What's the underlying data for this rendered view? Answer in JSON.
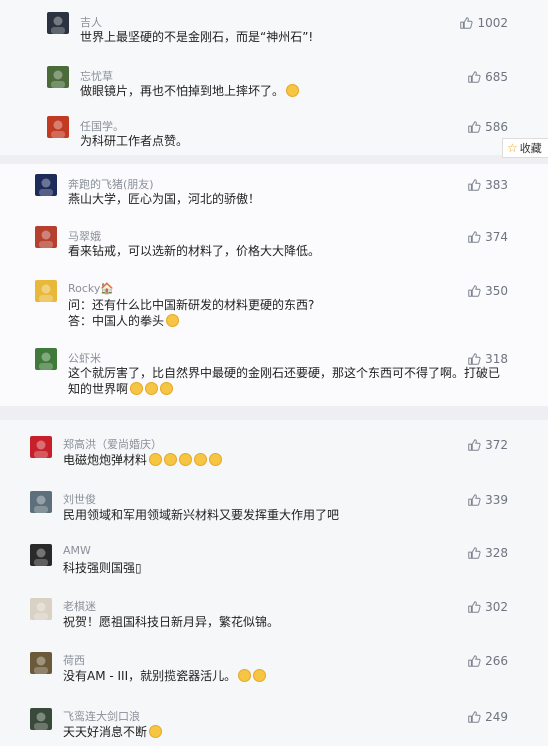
{
  "favorite": {
    "label": "收藏",
    "icon": "star-icon"
  },
  "card1": [
    {
      "user": "吉人",
      "text": "世界上最坚硬的不是金刚石，而是“神州石”!",
      "likes": "1002",
      "avatar_color": "#2b3340"
    },
    {
      "user": "忘忧草",
      "text": "做眼镜片，再也不怕掉到地上摔坏了。",
      "likes": "685",
      "avatar_color": "#4b6b3a",
      "emoji": 1
    },
    {
      "user": "任国学。",
      "text": "为科研工作者点赞。",
      "likes": "586",
      "avatar_color": "#c23a22"
    }
  ],
  "card2": [
    {
      "user": "奔跑的飞猪(朋友)",
      "text": "燕山大学，匠心为国，河北的骄傲！",
      "likes": "383",
      "avatar_color": "#1c2b5a"
    },
    {
      "user": "马翠娥",
      "text": "看来钻戒，可以选新的材料了，价格大大降低。",
      "likes": "374",
      "avatar_color": "#b5402e"
    },
    {
      "user": "Rocky🏠",
      "text": "问：还有什么比中国新研发的材料更硬的东西?",
      "text2": "答：中国人的拳头",
      "likes": "350",
      "avatar_color": "#e8b83a",
      "emoji2": 1
    },
    {
      "user": "公虾米",
      "text": "这个就厉害了，比自然界中最硬的金刚石还要硬，那这个东西可不得了啊。打破已",
      "text2": "知的世界啊",
      "likes": "318",
      "avatar_color": "#3f7a3a",
      "emoji2": 3
    }
  ],
  "card3": [
    {
      "user": "郑高洪（爱尚婚庆）",
      "text": "电磁炮炮弹材料",
      "likes": "372",
      "avatar_color": "#c8202a",
      "emoji": 5
    },
    {
      "user": "刘世俊",
      "text": "民用领域和军用领域新兴材料又要发挥重大作用了吧",
      "likes": "339",
      "avatar_color": "#5d6f7a"
    },
    {
      "user": "AMW",
      "text": "科技强则国强▯",
      "likes": "328",
      "avatar_color": "#2a2a2a"
    },
    {
      "user": "老棋迷",
      "text": "祝贺！愿祖国科技日新月异，繁花似锦。",
      "likes": "302",
      "avatar_color": "#d9d2c4"
    },
    {
      "user": "荷西",
      "text": "没有AM - III，就别揽瓷器活儿。",
      "likes": "266",
      "avatar_color": "#6b5a3a",
      "emoji": 2
    },
    {
      "user": "飞鸾连大剑口浪",
      "text": "天天好消息不断",
      "likes": "249",
      "avatar_color": "#3a4a3a",
      "emoji": 1
    }
  ]
}
